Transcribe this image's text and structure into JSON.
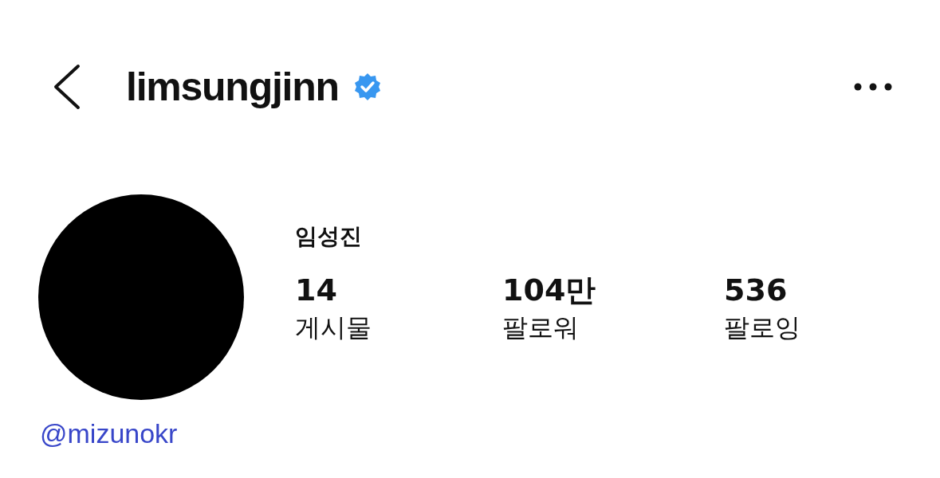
{
  "header": {
    "username": "limsungjinn",
    "verified": true
  },
  "profile": {
    "name": "임성진",
    "stats": [
      {
        "value": "14",
        "label": "게시물"
      },
      {
        "value": "104만",
        "label": "팔로워"
      },
      {
        "value": "536",
        "label": "팔로잉"
      }
    ]
  },
  "link": "@mizunokr"
}
